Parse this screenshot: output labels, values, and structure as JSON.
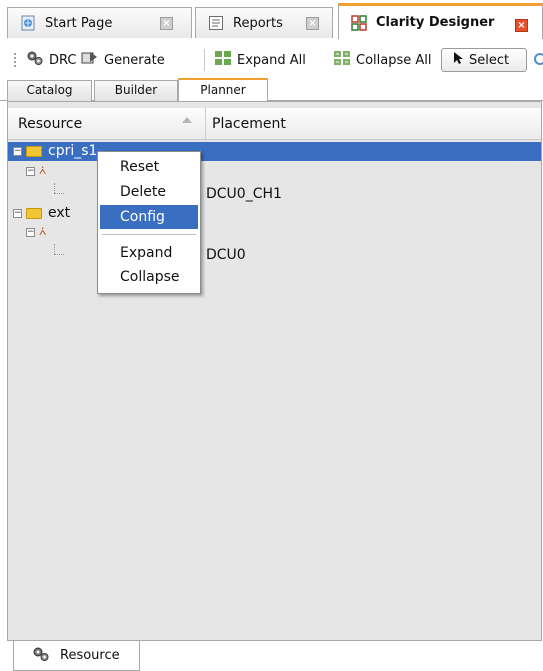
{
  "editor_tabs": [
    {
      "label": "Start Page",
      "icon": "globe-page-icon",
      "active": false
    },
    {
      "label": "Reports",
      "icon": "report-icon",
      "active": false
    },
    {
      "label": "Clarity Designer",
      "icon": "clarity-designer-icon",
      "active": true
    }
  ],
  "toolbar": {
    "drc": "DRC",
    "generate": "Generate",
    "expand_all": "Expand All",
    "collapse_all": "Collapse All",
    "select": "Select"
  },
  "sub_tabs": [
    "Catalog",
    "Builder",
    "Planner"
  ],
  "columns": {
    "resource": "Resource",
    "placement": "Placement"
  },
  "tree": {
    "row0": {
      "label": "cpri_s1",
      "placement": ""
    },
    "row2": {
      "placement": "DCU0_CH1"
    },
    "row3": {
      "label": "ext"
    },
    "row5": {
      "placement": "DCU0"
    }
  },
  "context_menu": {
    "reset": "Reset",
    "delete": "Delete",
    "config": "Config",
    "expand": "Expand",
    "collapse": "Collapse"
  },
  "bottom_tab": {
    "label": "Resource"
  },
  "colors": {
    "selection": "#3a6ec0",
    "active_tab_accent": "#f0a030",
    "close_active": "#e8502a",
    "folder": "#f2c532"
  }
}
